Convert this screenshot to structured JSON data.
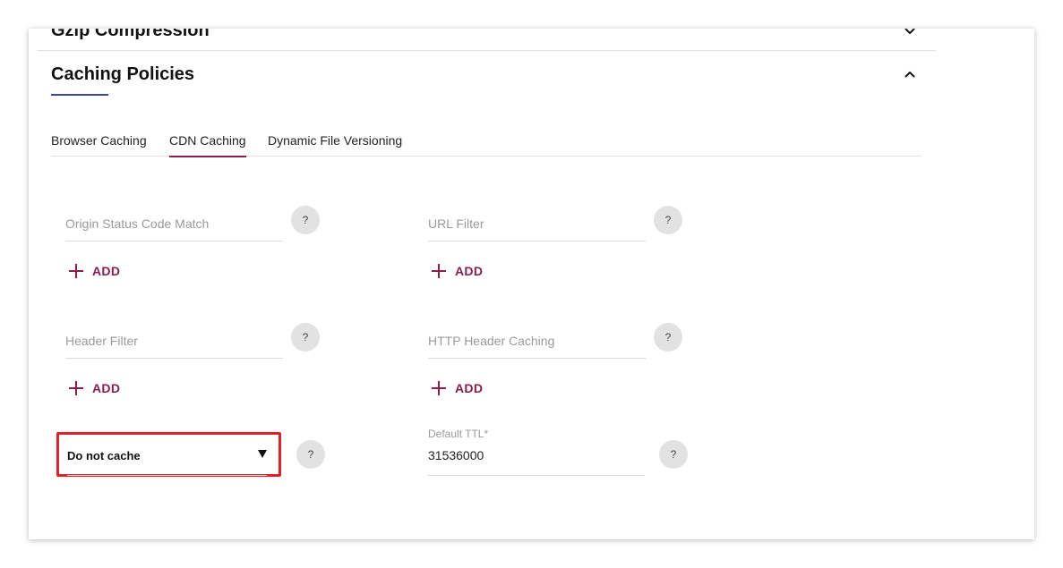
{
  "sections": {
    "gzip": {
      "title": "Gzip Compression"
    },
    "caching": {
      "title": "Caching Policies"
    }
  },
  "tabs": [
    {
      "label": "Browser Caching",
      "active": false
    },
    {
      "label": "CDN Caching",
      "active": true
    },
    {
      "label": "Dynamic File Versioning",
      "active": false
    }
  ],
  "fields": {
    "origin_status": {
      "placeholder": "Origin Status Code Match",
      "help": "?",
      "add_label": "ADD"
    },
    "url_filter": {
      "placeholder": "URL Filter",
      "help": "?",
      "add_label": "ADD"
    },
    "header_filter": {
      "placeholder": "Header Filter",
      "help": "?",
      "add_label": "ADD"
    },
    "http_header_caching": {
      "placeholder": "HTTP Header Caching",
      "help": "?",
      "add_label": "ADD"
    }
  },
  "cache_mode": {
    "value": "Do not cache",
    "help": "?"
  },
  "default_ttl": {
    "label": "Default TTL*",
    "value": "31536000",
    "help": "?"
  },
  "colors": {
    "accent": "#8c1d4f",
    "title_underline": "#3a4a9b",
    "highlight_border": "#e0222a"
  },
  "icons": {
    "gzip_toggle": "chevron-down-icon",
    "caching_toggle": "chevron-up-icon",
    "add": "plus-icon",
    "help": "question-icon",
    "select": "caret-down-icon"
  }
}
